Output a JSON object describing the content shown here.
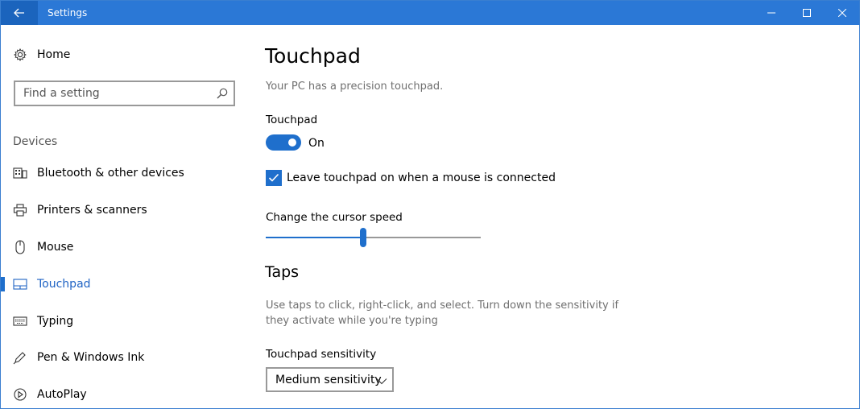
{
  "window": {
    "title": "Settings"
  },
  "sidebar": {
    "home_label": "Home",
    "search_placeholder": "Find a setting",
    "section_heading": "Devices",
    "items": [
      {
        "label": "Bluetooth & other devices",
        "icon": "bluetooth-devices-icon",
        "active": false
      },
      {
        "label": "Printers & scanners",
        "icon": "printer-icon",
        "active": false
      },
      {
        "label": "Mouse",
        "icon": "mouse-icon",
        "active": false
      },
      {
        "label": "Touchpad",
        "icon": "touchpad-icon",
        "active": true
      },
      {
        "label": "Typing",
        "icon": "keyboard-icon",
        "active": false
      },
      {
        "label": "Pen & Windows Ink",
        "icon": "pen-icon",
        "active": false
      },
      {
        "label": "AutoPlay",
        "icon": "autoplay-icon",
        "active": false
      }
    ]
  },
  "main": {
    "title": "Touchpad",
    "subtitle": "Your PC has a precision touchpad.",
    "touchpad_label": "Touchpad",
    "toggle_state": "On",
    "toggle_on": true,
    "checkbox_label": "Leave touchpad on when a mouse is connected",
    "checkbox_checked": true,
    "cursor_speed_label": "Change the cursor speed",
    "cursor_speed_fraction": 0.45,
    "taps_heading": "Taps",
    "taps_description": "Use taps to click, right-click, and select. Turn down the sensitivity if they activate while you're typing",
    "sensitivity_label": "Touchpad sensitivity",
    "sensitivity_value": "Medium sensitivity"
  },
  "colors": {
    "titlebar": "#2b78d6",
    "accent": "#1f6fcc"
  }
}
